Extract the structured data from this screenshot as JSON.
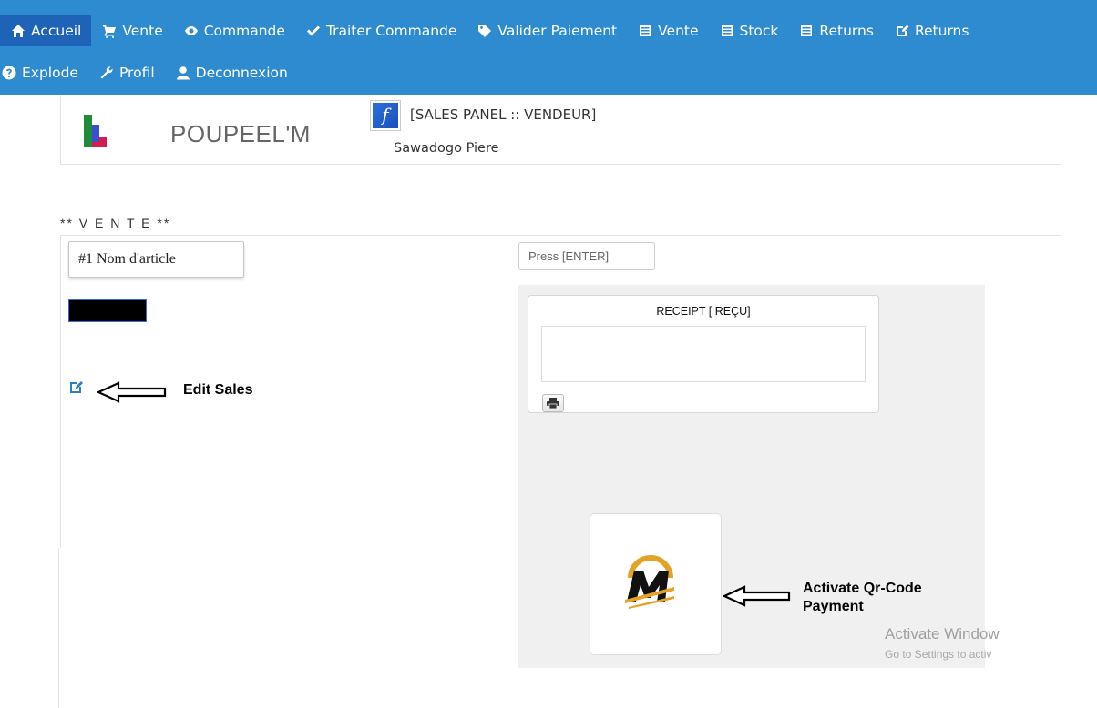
{
  "nav": {
    "row1": [
      {
        "label": "Accueil",
        "icon": "home-icon",
        "active": true
      },
      {
        "label": "Vente",
        "icon": "cart-icon"
      },
      {
        "label": "Commande",
        "icon": "eye-icon"
      },
      {
        "label": "Traiter Commande",
        "icon": "check-icon"
      },
      {
        "label": "Valider Paiement",
        "icon": "tag-icon"
      },
      {
        "label": "Vente",
        "icon": "list-icon"
      },
      {
        "label": "Stock",
        "icon": "list-icon"
      },
      {
        "label": "Returns",
        "icon": "list-icon"
      },
      {
        "label": "Returns",
        "icon": "edit-icon"
      }
    ],
    "row2": [
      {
        "label": "Explode",
        "icon": "question-icon"
      },
      {
        "label": "Profil",
        "icon": "wrench-icon"
      },
      {
        "label": "Deconnexion",
        "icon": "user-icon"
      }
    ]
  },
  "header": {
    "brand": "POUPEEL'M",
    "panel_title": "[SALES PANEL :: VENDEUR]",
    "user": "Sawadogo Piere",
    "panel_icon_letter": "f"
  },
  "sale": {
    "section_label": "** V E N T E **",
    "article_placeholder": "#1 Nom d'article",
    "edit_label": "Edit Sales",
    "enter_placeholder": "Press [ENTER]",
    "receipt_title": "RECEIPT [ REÇU]",
    "qr_line1": "Activate Qr-Code",
    "qr_line2": "Payment"
  },
  "watermark": {
    "line1": "Activate Window",
    "line2": "Go to Settings to activ"
  },
  "colors": {
    "nav_bg": "#2f8bcf",
    "nav_active": "#1f63b8",
    "logo_gold": "#e3a326"
  }
}
